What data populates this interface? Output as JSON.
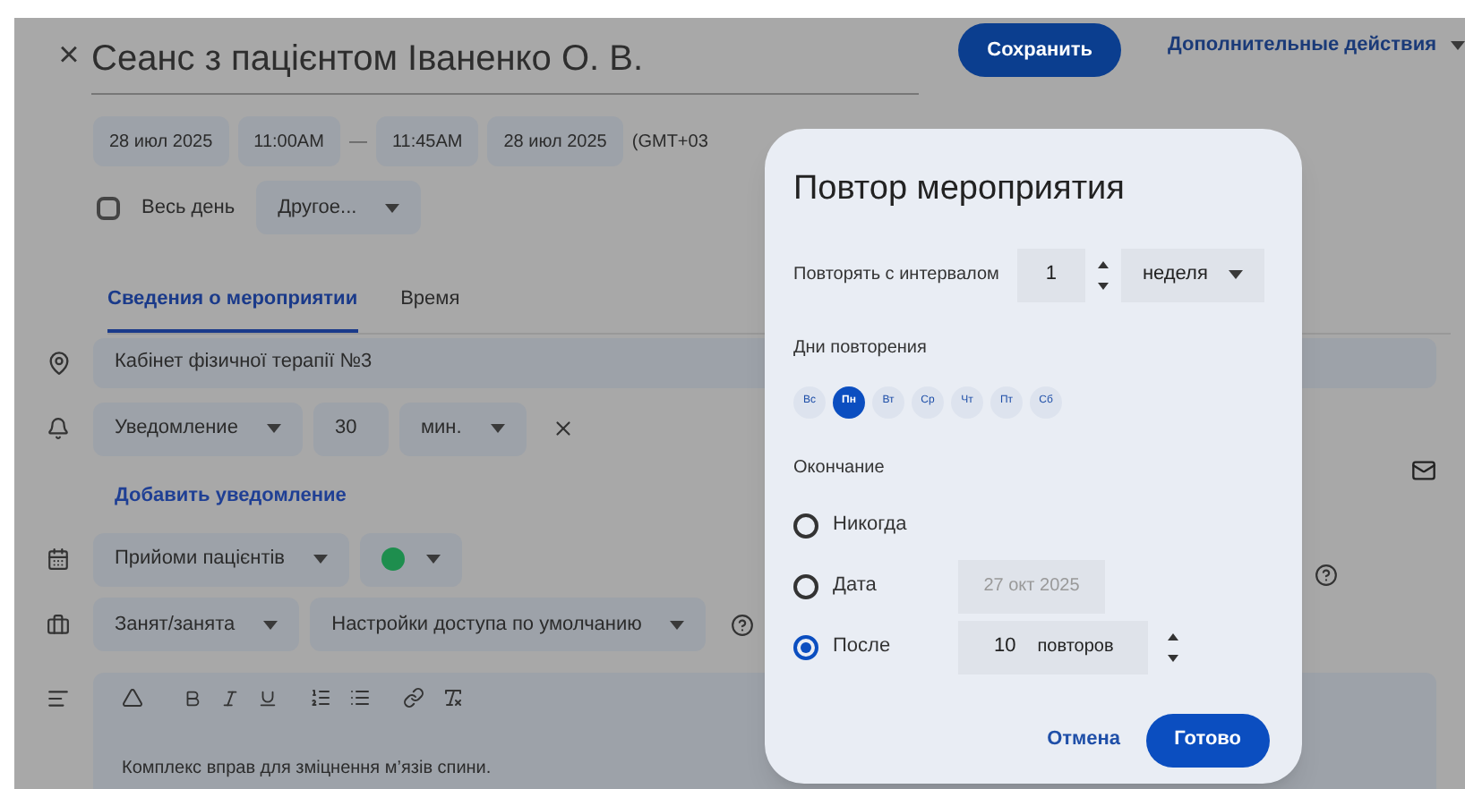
{
  "header": {
    "close": "×",
    "title": "Сеанс з пацієнтом Іваненко О. В.",
    "save_button": "Сохранить",
    "more_actions": "Дополнительные действия"
  },
  "date_time": {
    "start_date": "28 июл 2025",
    "start_time": "11:00AM",
    "separator": "—",
    "end_time": "11:45AM",
    "end_date": "28 июл 2025",
    "timezone": "(GMT+03"
  },
  "all_day": {
    "label": "Весь день",
    "checked": false
  },
  "recurrence_select": "Другое...",
  "tabs": [
    {
      "label": "Сведения о мероприятии",
      "selected": true
    },
    {
      "label": "Время",
      "selected": false
    }
  ],
  "location": "Кабінет фізичної терапії №3",
  "notification": {
    "type": "Уведомление",
    "value": "30",
    "unit": "мин."
  },
  "add_notification": "Добавить уведомление",
  "calendar": {
    "name": "Прийоми пацієнтів",
    "color": "#1e8e4e"
  },
  "availability": "Занят/занята",
  "visibility": "Настройки доступа по умолчанию",
  "description": "Комплекс вправ для зміцнення м’язів спини.",
  "dialog": {
    "title": "Повтор мероприятия",
    "interval_label": "Повторять с интервалом",
    "interval_value": "1",
    "interval_unit": "неделя",
    "days_label": "Дни повторения",
    "days": [
      {
        "label": "Вс",
        "selected": false
      },
      {
        "label": "Пн",
        "selected": true
      },
      {
        "label": "Вт",
        "selected": false
      },
      {
        "label": "Ср",
        "selected": false
      },
      {
        "label": "Чт",
        "selected": false
      },
      {
        "label": "Пт",
        "selected": false
      },
      {
        "label": "Сб",
        "selected": false
      }
    ],
    "end_label": "Окончание",
    "end_options": [
      {
        "kind": "never",
        "label": "Никогда",
        "selected": false
      },
      {
        "kind": "date",
        "label": "Дата",
        "selected": false,
        "placeholder": "27 окт 2025"
      },
      {
        "kind": "count",
        "label": "После",
        "selected": true,
        "value": "10",
        "unit": "повторов"
      }
    ],
    "cancel": "Отмена",
    "done": "Готово"
  }
}
